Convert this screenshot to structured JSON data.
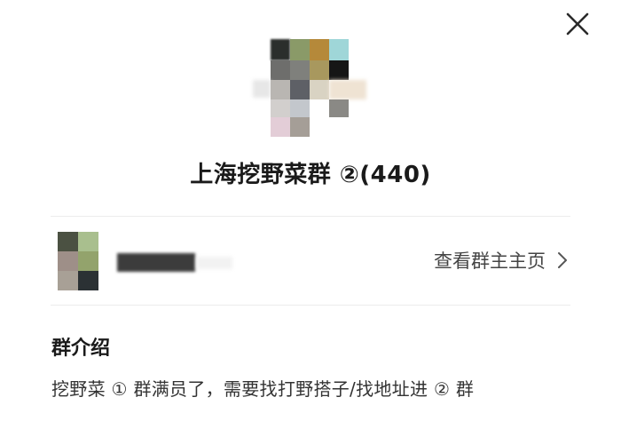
{
  "dialog": {
    "close_icon": "close-icon"
  },
  "group": {
    "name": "上海挖野菜群 ②(440)"
  },
  "owner": {
    "link_label": "查看群主主页",
    "chevron_icon": "chevron-right-icon"
  },
  "intro": {
    "heading": "群介绍",
    "text": "挖野菜 ① 群满员了，需要找打野搭子/找地址进 ② 群"
  },
  "colors": {
    "divider": "#ececec",
    "text_primary": "#1a1a1a",
    "text_secondary": "#444444"
  }
}
